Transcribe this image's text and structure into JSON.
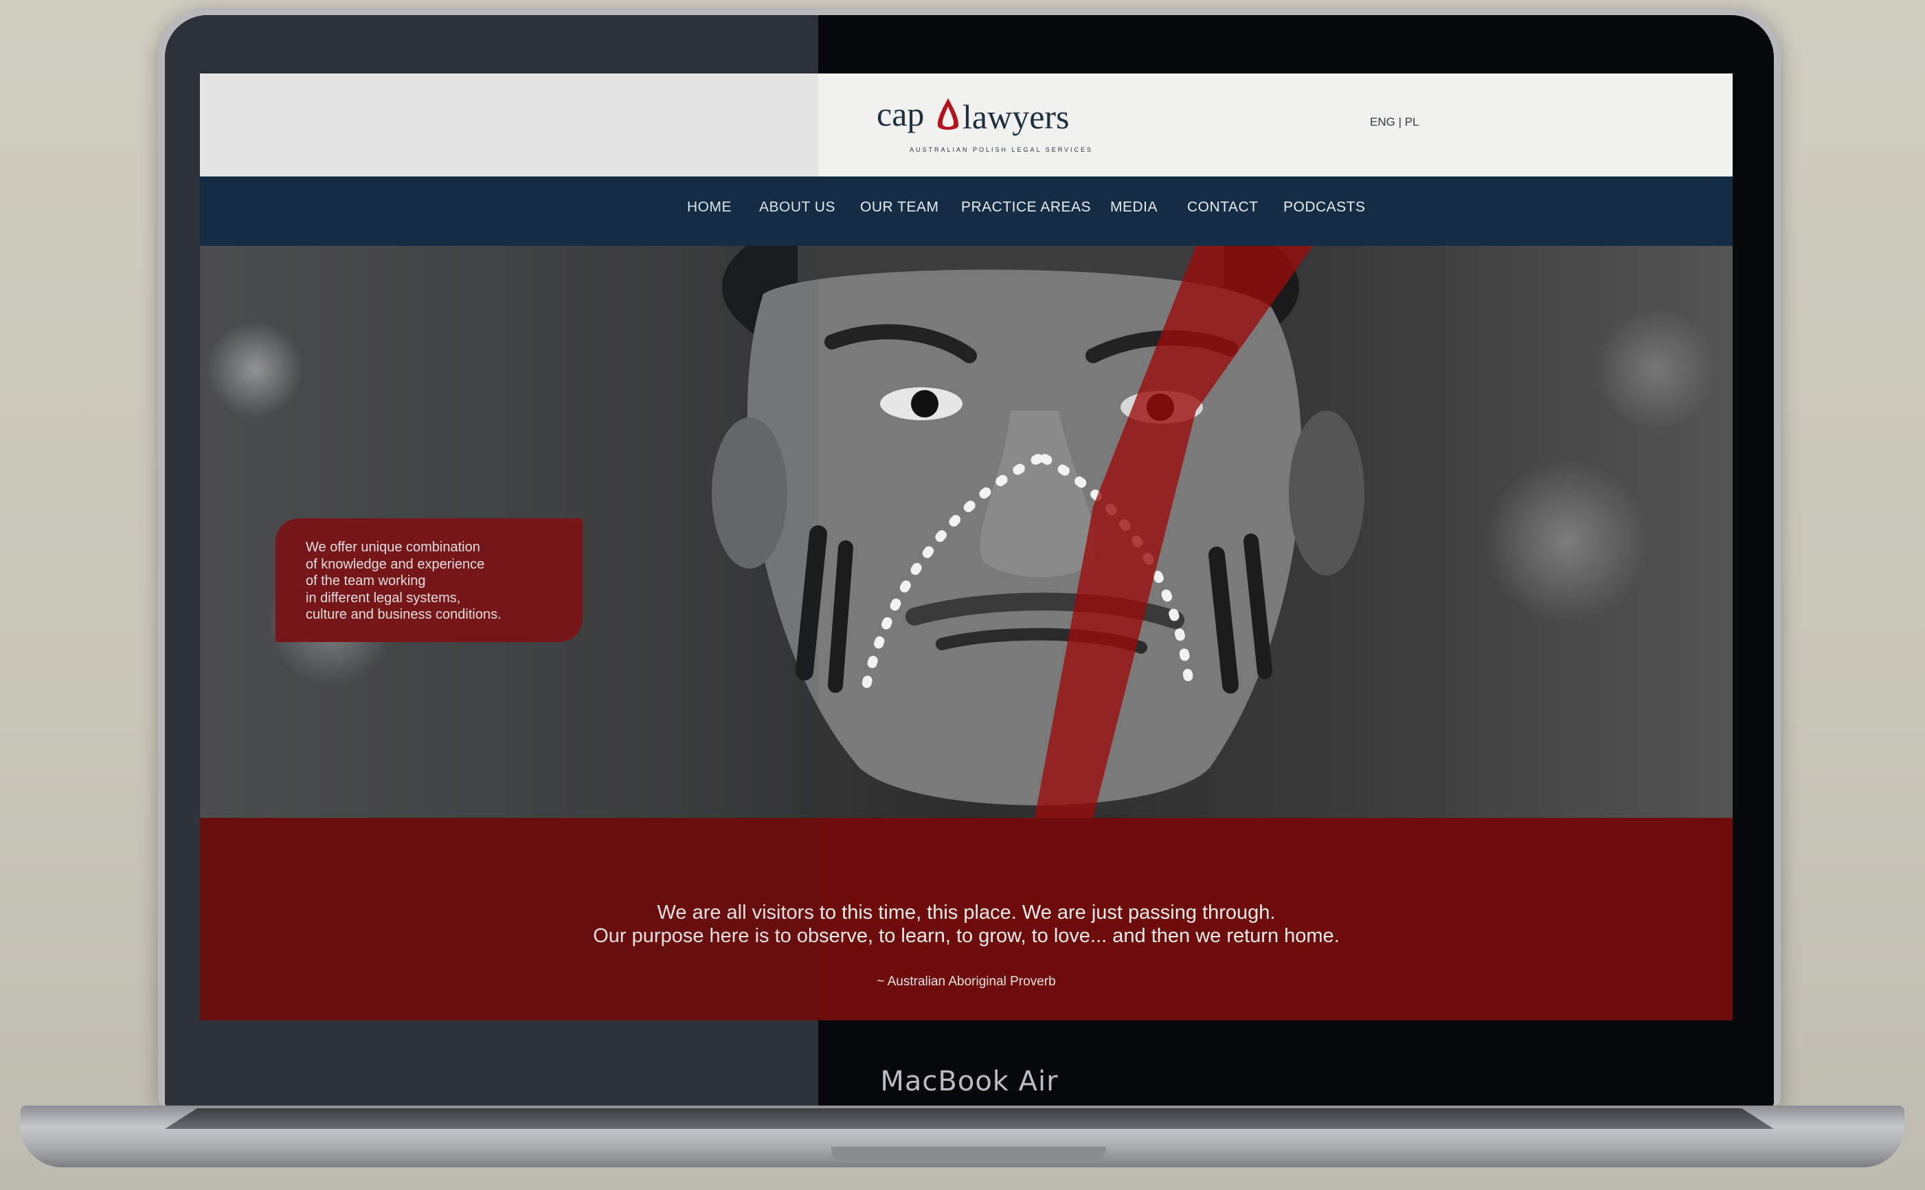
{
  "header": {
    "logo": {
      "word_left": "cap",
      "word_right": "lawyers",
      "tagline": "AUSTRALIAN POLISH LEGAL SERVICES"
    },
    "lang": {
      "eng": "ENG",
      "separator": " | ",
      "pl": "PL"
    }
  },
  "nav": {
    "items": [
      {
        "label": "HOME"
      },
      {
        "label": "ABOUT US"
      },
      {
        "label": "OUR TEAM"
      },
      {
        "label": "PRACTICE AREAS"
      },
      {
        "label": "MEDIA"
      },
      {
        "label": "CONTACT"
      },
      {
        "label": "PODCASTS"
      }
    ]
  },
  "hero": {
    "info_lines": [
      "We offer unique combination",
      "of knowledge and experience",
      "of the team working",
      "in different legal systems,",
      "culture and business conditions."
    ]
  },
  "quote": {
    "line1": "We are all visitors to this time, this place. We are just passing through.",
    "line2": "Our purpose here is to observe, to learn, to grow, to love... and then we return home.",
    "source": "~ Australian Aboriginal Proverb"
  },
  "device": {
    "label": "MacBook Air"
  },
  "colors": {
    "nav_bg": "#142d45",
    "accent_red": "#7d1517",
    "quote_band": "#6e0c0c",
    "header_bg": "#f1f1ef"
  }
}
